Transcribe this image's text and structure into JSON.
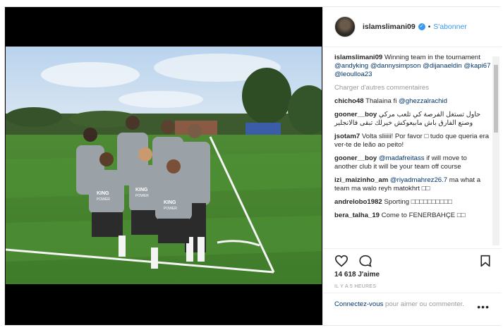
{
  "header": {
    "username": "islamslimani09",
    "dot": "•",
    "follow_label": "S'abonner"
  },
  "caption": {
    "username": "islamslimani09",
    "text": "Winning team in the tournament",
    "mentions": [
      "@andyking",
      "@dannysimpson",
      "@dijanaeldin",
      "@kapi67",
      "@leoulloa23"
    ]
  },
  "load_more_label": "Charger d'autres commentaires",
  "comments": [
    {
      "user": "chicho48",
      "text": "Thalaina fi",
      "mention": "@ghezzalrachid"
    },
    {
      "user": "gooner__boy",
      "text": "حاول تستغل الفرصة كي تلعب مركي وصنع الفارق باش مابيعوكش خيرلك تبقى فالانجلير",
      "mention": ""
    },
    {
      "user": "jsotam7",
      "text": "Volta sliiiii! Por favor □ tudo que queria era ver-te de leão ao peito!",
      "mention": ""
    },
    {
      "user": "gooner__boy",
      "text": "if will move to another club it will be your team off course",
      "mention": "@madafreitass"
    },
    {
      "user": "izi_maizinho_am",
      "text": "ma what a team ma walo reyh matokhrt □□",
      "mention": "@riyadmahrez26.7"
    },
    {
      "user": "andrelobo1982",
      "text": "Sporting □□□□□□□□□□",
      "mention": ""
    },
    {
      "user": "bera_talha_19",
      "text": "Come to FENERBAHÇE □□",
      "mention": ""
    }
  ],
  "actions": {
    "likes": "14 618 J'aime",
    "time": "IL Y A 5 HEURES"
  },
  "login": {
    "link": "Connectez-vous",
    "text": " pour aimer ou commenter.",
    "more": "•••"
  },
  "photo": {
    "shirt_text_1": "KING",
    "shirt_text_2": "POWER"
  },
  "colors": {
    "link": "#003569",
    "accent": "#3897f0",
    "muted": "#999999"
  }
}
